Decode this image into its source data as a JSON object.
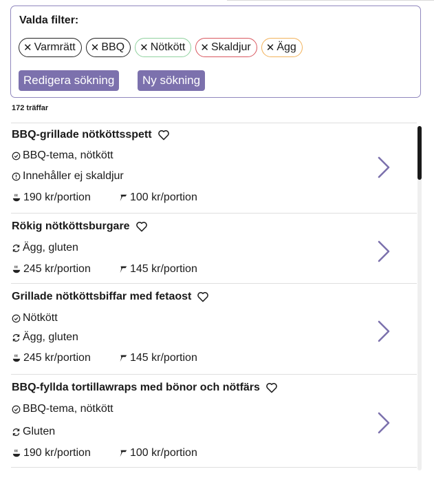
{
  "filters": {
    "title": "Valda filter:",
    "chips": [
      {
        "label": "Varmrätt",
        "color": "#222222"
      },
      {
        "label": "BBQ",
        "color": "#222222"
      },
      {
        "label": "Nötkött",
        "color": "#8fd19e"
      },
      {
        "label": "Skaldjur",
        "color": "#d9575f"
      },
      {
        "label": "Ägg",
        "color": "#f2b25b"
      }
    ],
    "edit_label": "Redigera sökning",
    "new_label": "Ny sökning"
  },
  "results": {
    "count": "172 träffar",
    "items": [
      {
        "title": "BBQ-grillade nötköttsspett",
        "rows": [
          {
            "icon": "check-circle-icon",
            "text": "BBQ-tema, nötkött"
          },
          {
            "icon": "info-circle-icon",
            "text": "Innehåller ej skaldjur"
          }
        ],
        "price_portion": "190 kr/portion",
        "price_ingredients": "100 kr/portion"
      },
      {
        "title": "Rökig nötköttsburgare",
        "rows": [
          {
            "icon": "swap-icon",
            "text": "Ägg, gluten"
          }
        ],
        "price_portion": "245 kr/portion",
        "price_ingredients": "145 kr/portion"
      },
      {
        "title": "Grillade nötköttsbiffar med fetaost",
        "rows": [
          {
            "icon": "check-circle-icon",
            "text": "Nötkött"
          },
          {
            "icon": "swap-icon",
            "text": "Ägg, gluten"
          }
        ],
        "price_portion": "245 kr/portion",
        "price_ingredients": "145 kr/portion"
      },
      {
        "title": "BBQ-fyllda tortillawraps med bönor och nötfärs",
        "rows": [
          {
            "icon": "check-circle-icon",
            "text": "BBQ-tema, nötkött"
          },
          {
            "icon": "swap-icon",
            "text": "Gluten"
          }
        ],
        "price_portion": "190 kr/portion",
        "price_ingredients": "100 kr/portion"
      }
    ]
  },
  "colors": {
    "accent": "#7c71ad",
    "border": "#8f86bd"
  }
}
